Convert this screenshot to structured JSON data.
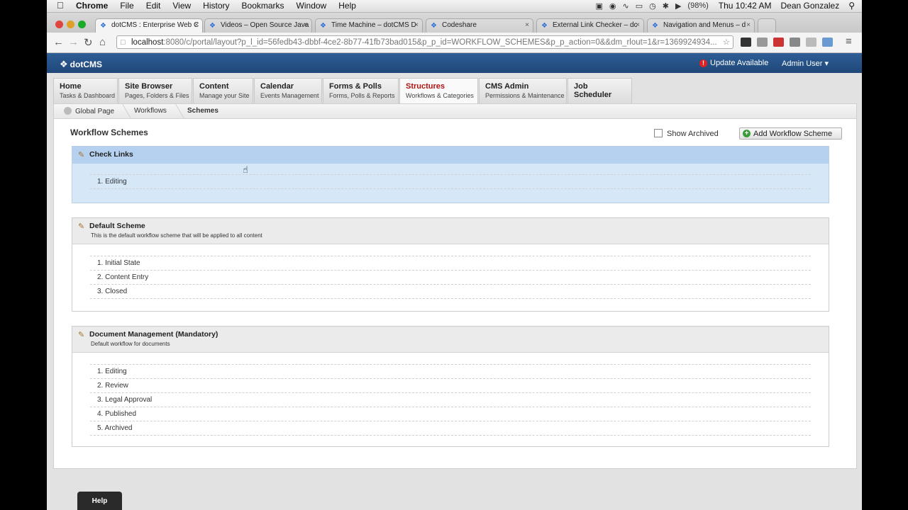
{
  "menubar": {
    "app": "Chrome",
    "items": [
      "File",
      "Edit",
      "View",
      "History",
      "Bookmarks",
      "Window",
      "Help"
    ],
    "battery": "(98%)",
    "clock": "Thu 10:42 AM",
    "user": "Dean Gonzalez"
  },
  "tabs": [
    {
      "label": "dotCMS : Enterprise Web C"
    },
    {
      "label": "Videos – Open Source Java"
    },
    {
      "label": "Time Machine – dotCMS D"
    },
    {
      "label": "Codeshare"
    },
    {
      "label": "External Link Checker – dc"
    },
    {
      "label": "Navigation and Menus – d"
    }
  ],
  "address": {
    "host": "localhost",
    "rest": ":8080/c/portal/layout?p_l_id=56fedb43-dbbf-4ce2-8b77-41fb73bad015&p_p_id=WORKFLOW_SCHEMES&p_p_action=0&&dm_rlout=1&r=1369924934..."
  },
  "header": {
    "logo": "dotCMS",
    "update": "Update Available",
    "admin": "Admin User"
  },
  "nav": [
    {
      "title": "Home",
      "sub": "Tasks & Dashboard"
    },
    {
      "title": "Site Browser",
      "sub": "Pages, Folders & Files"
    },
    {
      "title": "Content",
      "sub": "Manage your Site"
    },
    {
      "title": "Calendar",
      "sub": "Events Management"
    },
    {
      "title": "Forms & Polls",
      "sub": "Forms, Polls & Reports"
    },
    {
      "title": "Structures",
      "sub": "Workflows & Categories"
    },
    {
      "title": "CMS Admin",
      "sub": "Permissions & Maintenance"
    },
    {
      "title": "Job Scheduler",
      "sub": ""
    }
  ],
  "breadcrumb": [
    "Global Page",
    "Workflows",
    "Schemes"
  ],
  "page": {
    "title": "Workflow Schemes",
    "show_archived": "Show Archived",
    "add_button": "Add Workflow Scheme"
  },
  "schemes": [
    {
      "name": "Check Links",
      "desc": "",
      "steps": [
        "1. Editing"
      ]
    },
    {
      "name": "Default Scheme",
      "desc": "This is the default workflow scheme that will be applied to all content",
      "steps": [
        "1. Initial State",
        "2. Content Entry",
        "3. Closed"
      ]
    },
    {
      "name": "Document Management (Mandatory)",
      "desc": "Default workflow for documents",
      "steps": [
        "1. Editing",
        "2. Review",
        "3. Legal Approval",
        "4. Published",
        "5. Archived"
      ]
    }
  ],
  "help": "Help",
  "colors": {
    "header": "#1f4778",
    "active_nav": "#b11313",
    "selected_scheme": "#b5d1ef"
  }
}
